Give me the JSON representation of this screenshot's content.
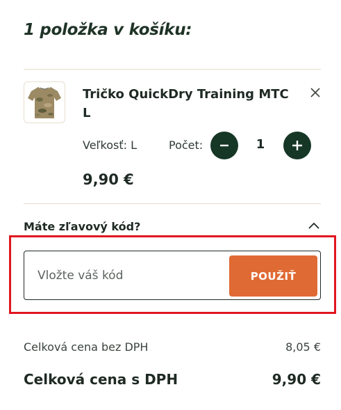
{
  "cart": {
    "title": "1 položka v košíku:"
  },
  "item": {
    "image_icon": "tshirt-camo-icon",
    "name": "Tričko QuickDry Training MTC L",
    "size_text": "Veľkosť: L",
    "qty_label": "Počet:",
    "quantity": "1",
    "price": "9,90 €",
    "remove_icon": "close-icon",
    "minus_icon": "minus-icon",
    "plus_icon": "plus-icon"
  },
  "discount": {
    "toggle_label": "Máte zľavový kód?",
    "toggle_icon": "chevron-up-icon",
    "input_placeholder": "Vložte váš kód",
    "input_value": "",
    "apply_label": "POUŽIŤ"
  },
  "totals": {
    "net_label": "Celková cena bez DPH",
    "net_value": "8,05 €",
    "gross_label": "Celková cena s DPH",
    "gross_value": "9,90 €"
  },
  "colors": {
    "brand_dark": "#163626",
    "accent_orange": "#e06a33",
    "highlight_red": "#e0161f",
    "divider": "#e4dccb"
  }
}
